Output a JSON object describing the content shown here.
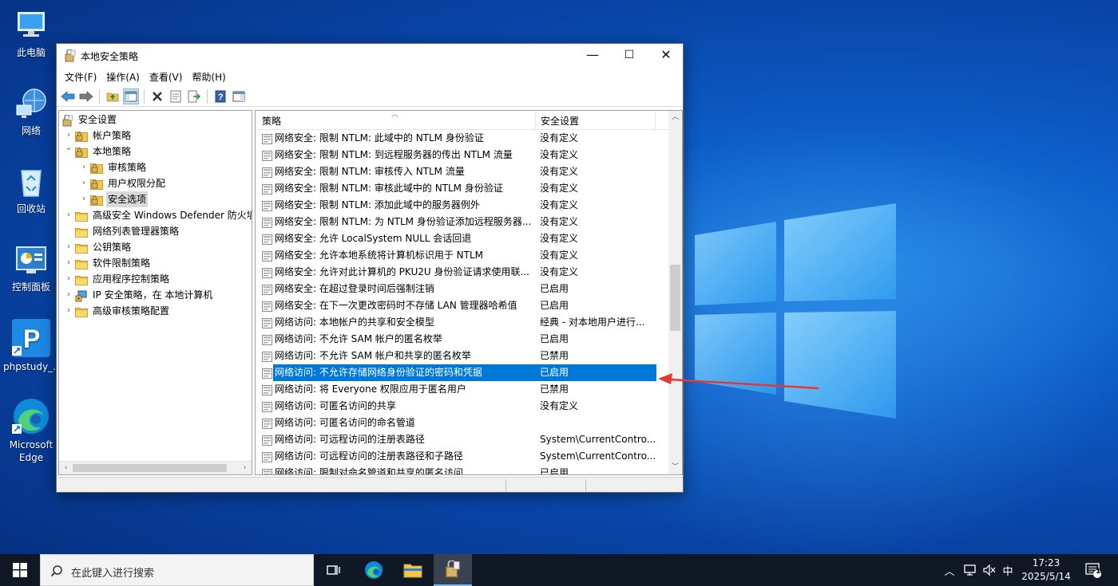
{
  "desktop": {
    "icons": [
      {
        "label": "此电脑",
        "icon": "computer-icon"
      },
      {
        "label": "网络",
        "icon": "network-icon"
      },
      {
        "label": "回收站",
        "icon": "recycle-bin-icon"
      },
      {
        "label": "控制面板",
        "icon": "control-panel-icon"
      },
      {
        "label": "phpstudy_...",
        "icon": "phpstudy-icon"
      },
      {
        "label": "Microsoft Edge",
        "icon": "edge-icon"
      }
    ]
  },
  "window": {
    "title": "本地安全策略",
    "controls": {
      "minimize": "—",
      "maximize": "☐",
      "close": "✕"
    },
    "menu": [
      "文件(F)",
      "操作(A)",
      "查看(V)",
      "帮助(H)"
    ]
  },
  "tree": {
    "root": "安全设置",
    "items": [
      {
        "label": "帐户策略"
      },
      {
        "label": "本地策略"
      },
      {
        "label": "审核策略"
      },
      {
        "label": "用户权限分配"
      },
      {
        "label": "安全选项"
      },
      {
        "label": "高级安全 Windows Defender 防火墙"
      },
      {
        "label": "网络列表管理器策略"
      },
      {
        "label": "公钥策略"
      },
      {
        "label": "软件限制策略"
      },
      {
        "label": "应用程序控制策略"
      },
      {
        "label": "IP 安全策略，在 本地计算机"
      },
      {
        "label": "高级审核策略配置"
      }
    ]
  },
  "list": {
    "columns": [
      "策略",
      "安全设置"
    ],
    "rows": [
      {
        "name": "网络安全: 限制 NTLM: 此域中的 NTLM 身份验证",
        "value": "没有定义"
      },
      {
        "name": "网络安全: 限制 NTLM: 到远程服务器的传出 NTLM 流量",
        "value": "没有定义"
      },
      {
        "name": "网络安全: 限制 NTLM: 审核传入 NTLM 流量",
        "value": "没有定义"
      },
      {
        "name": "网络安全: 限制 NTLM: 审核此域中的 NTLM 身份验证",
        "value": "没有定义"
      },
      {
        "name": "网络安全: 限制 NTLM: 添加此域中的服务器例外",
        "value": "没有定义"
      },
      {
        "name": "网络安全: 限制 NTLM: 为 NTLM 身份验证添加远程服务器...",
        "value": "没有定义"
      },
      {
        "name": "网络安全: 允许 LocalSystem NULL 会话回退",
        "value": "没有定义"
      },
      {
        "name": "网络安全: 允许本地系统将计算机标识用于 NTLM",
        "value": "没有定义"
      },
      {
        "name": "网络安全: 允许对此计算机的 PKU2U 身份验证请求使用联...",
        "value": "没有定义"
      },
      {
        "name": "网络安全: 在超过登录时间后强制注销",
        "value": "已启用"
      },
      {
        "name": "网络安全: 在下一次更改密码时不存储 LAN 管理器哈希值",
        "value": "已启用"
      },
      {
        "name": "网络访问: 本地帐户的共享和安全模型",
        "value": "经典 - 对本地用户进行..."
      },
      {
        "name": "网络访问: 不允许 SAM 帐户的匿名枚举",
        "value": "已启用"
      },
      {
        "name": "网络访问: 不允许 SAM 帐户和共享的匿名枚举",
        "value": "已禁用"
      },
      {
        "name": "网络访问: 不允许存储网络身份验证的密码和凭据",
        "value": "已启用"
      },
      {
        "name": "网络访问: 将 Everyone 权限应用于匿名用户",
        "value": "已禁用"
      },
      {
        "name": "网络访问: 可匿名访问的共享",
        "value": "没有定义"
      },
      {
        "name": "网络访问: 可匿名访问的命名管道",
        "value": ""
      },
      {
        "name": "网络访问: 可远程访问的注册表路径",
        "value": "System\\CurrentContro..."
      },
      {
        "name": "网络访问: 可远程访问的注册表路径和子路径",
        "value": "System\\CurrentContro..."
      },
      {
        "name": "网络访问: 限制对命名管道和共享的匿名访问",
        "value": "已启用"
      }
    ],
    "selected_index": 14
  },
  "taskbar": {
    "search_placeholder": "在此键入进行搜索",
    "ime": "中",
    "time": "17:23",
    "date": "2025/5/14",
    "notification_count": "1"
  },
  "colors": {
    "selection": "#0078d7",
    "arrow": "#e53935"
  }
}
